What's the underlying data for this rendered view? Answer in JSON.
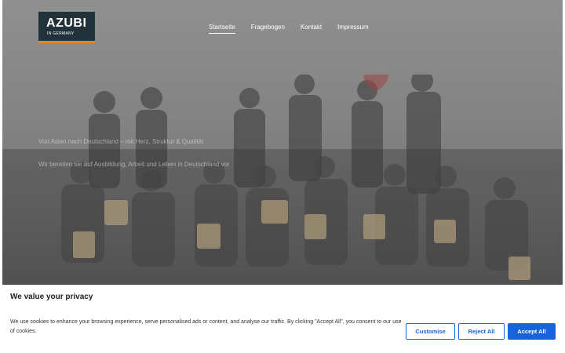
{
  "logo": {
    "title": "AZUBI",
    "subtitle": "IN GERMANY"
  },
  "nav": {
    "items": [
      {
        "label": "Startseite",
        "active": true
      },
      {
        "label": "Fragebogen",
        "active": false
      },
      {
        "label": "Kontakt",
        "active": false
      },
      {
        "label": "Impressum",
        "active": false
      }
    ]
  },
  "hero": {
    "line1": "Von Asien nach Deutschland – mit Herz, Struktur & Qualität",
    "line2": "Wir bereiten sie auf Ausbildung, Arbeit und Leben in Deutschland vor"
  },
  "cookie": {
    "title": "We value your privacy",
    "text": "We use cookies to enhance your browsing experience, serve personalised ads or content, and analyse our traffic. By clicking \"Accept All\", you consent to our use of cookies.",
    "customise_label": "Customise",
    "reject_label": "Reject All",
    "accept_label": "Accept All"
  },
  "colors": {
    "accent": "#1863dc",
    "logo_bg": "#22323a",
    "logo_bar": "#e0862a"
  }
}
